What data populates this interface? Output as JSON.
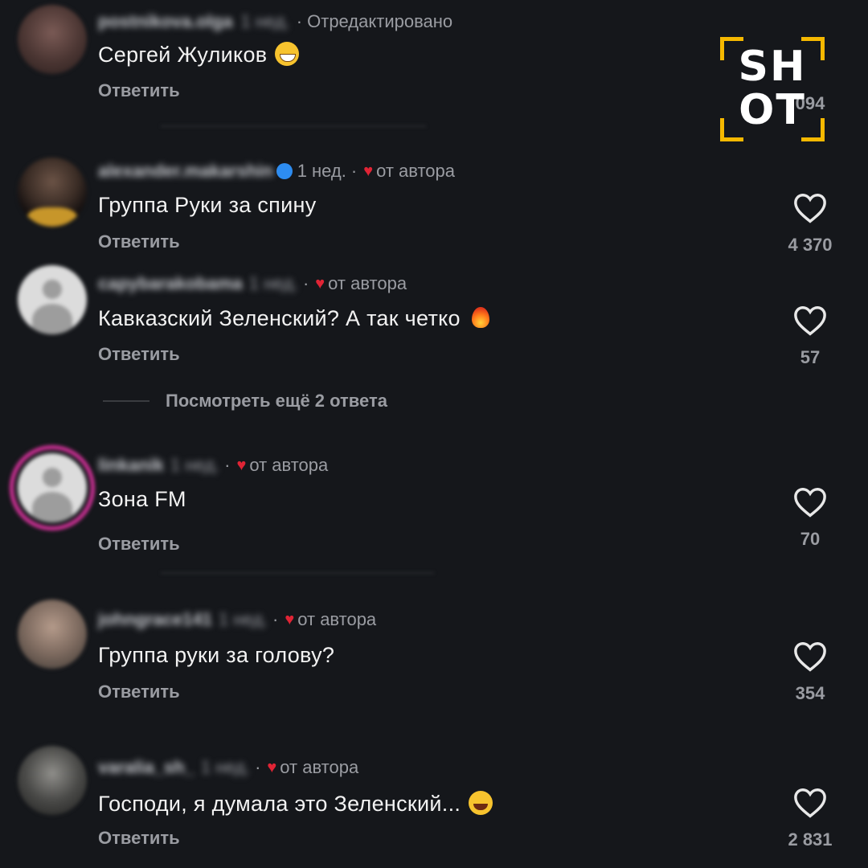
{
  "reply_label": "Ответить",
  "from_author": "от автора",
  "more_replies": "Посмотреть ещё 2 ответа",
  "logo": {
    "line1": "SH",
    "line2": "OT",
    "accent": "#f5b800"
  },
  "comments": [
    {
      "username": "postnikova.olga",
      "time": "1 нед.",
      "edited": "· Отредактировано",
      "text": "Сергей Жуликов",
      "likes": "094"
    },
    {
      "username": "alexander.makarshin",
      "time": "1 нед.",
      "text": "Группа Руки за спину",
      "likes": "4 370"
    },
    {
      "username": "capybarakobama",
      "time": "1 нед.",
      "text": "Кавказский Зеленский? А так четко",
      "likes": "57"
    },
    {
      "username": "linkanik",
      "time": "1 нед.",
      "text": "Зона FM",
      "likes": "70"
    },
    {
      "username": "johngrace141",
      "time": "1 нед.",
      "text": "Группа руки за голову?",
      "likes": "354"
    },
    {
      "username": "varalia_sh_",
      "time": "1 нед.",
      "text": "Господи,  я думала это Зеленский...",
      "likes": "2 831"
    }
  ]
}
